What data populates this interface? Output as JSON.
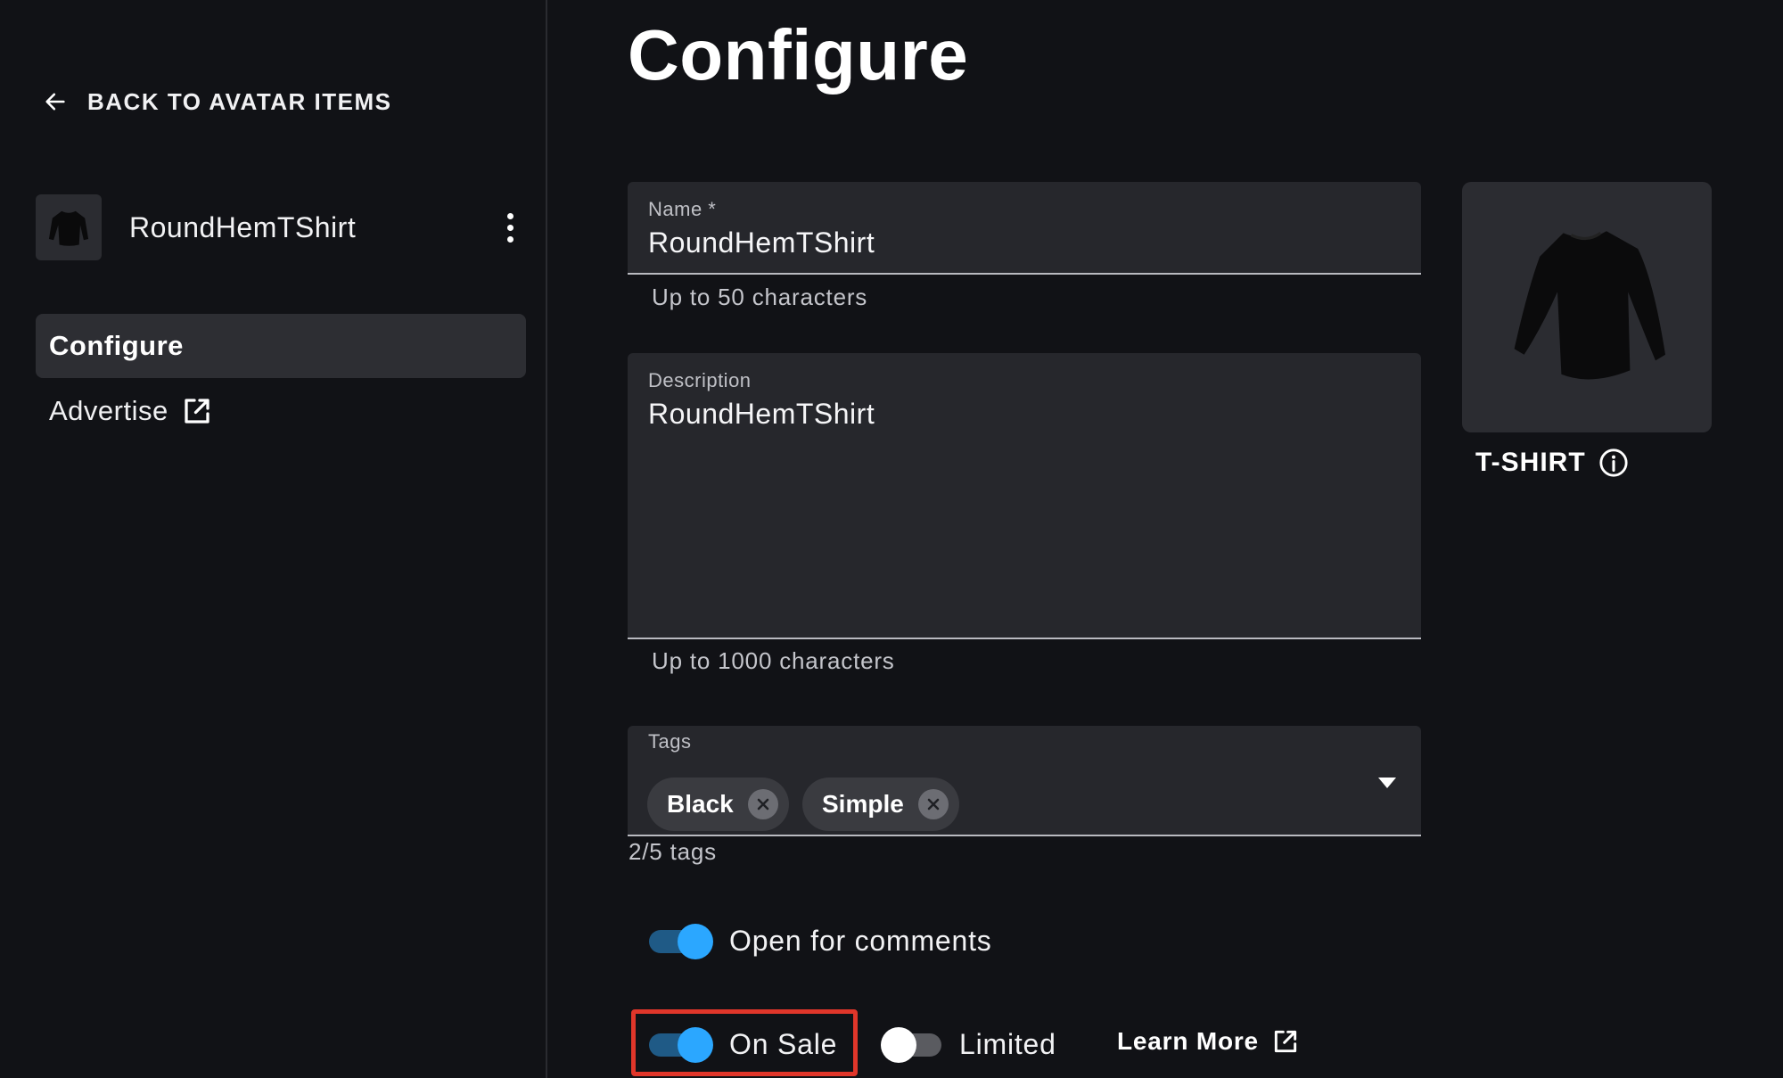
{
  "sidebar": {
    "back_label": "BACK TO AVATAR ITEMS",
    "item_name": "RoundHemTShirt",
    "nav": [
      {
        "label": "Configure",
        "active": true
      },
      {
        "label": "Advertise",
        "active": false,
        "icon": "external-link-icon"
      }
    ]
  },
  "main": {
    "title": "Configure",
    "name_field": {
      "label": "Name *",
      "value": "RoundHemTShirt",
      "helper": "Up to 50 characters"
    },
    "description_field": {
      "label": "Description",
      "value": "RoundHemTShirt",
      "helper": "Up to 1000 characters"
    },
    "tags_field": {
      "label": "Tags",
      "tags": [
        "Black",
        "Simple"
      ],
      "helper": "2/5 tags"
    },
    "comments_toggle": {
      "label": "Open for comments",
      "on": true
    },
    "on_sale_toggle": {
      "label": "On Sale",
      "on": true
    },
    "limited_toggle": {
      "label": "Limited",
      "on": false
    },
    "learn_more": "Learn More"
  },
  "preview": {
    "type_label": "T-SHIRT"
  },
  "colors": {
    "background": "#111216",
    "field": "#26272c",
    "accent": "#2ba7ff",
    "highlight": "#e0362a"
  }
}
